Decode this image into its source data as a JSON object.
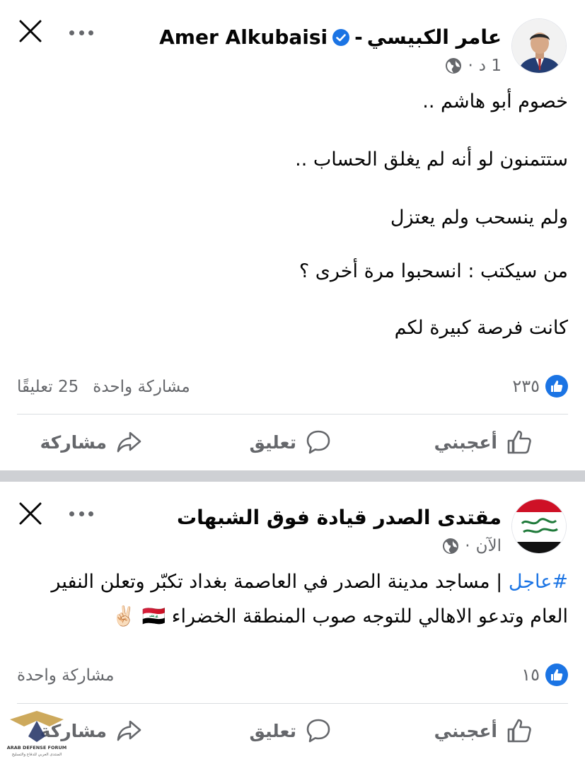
{
  "posts": [
    {
      "author": "Amer Alkubaisi  -  عامر الكبيسي",
      "author_ar": "عامر الكبيسي",
      "author_en": "Amer Alkubaisi",
      "author_sep": "-",
      "time": "1 د",
      "dot": "·",
      "body": [
        "خصوم أبو هاشم ..",
        "ستتمنون لو أنه لم يغلق الحساب ..",
        "ولم ينسحب ولم يعتزل",
        "من سيكتب : انسحبوا مرة أخرى ؟",
        "كانت فرصة كبيرة لكم"
      ],
      "likes": "٢٣٥",
      "shares": "مشاركة واحدة",
      "comments": "25 تعليقًا"
    },
    {
      "author": "مقتدى الصدر قيادة فوق الشبهات",
      "time": "الآن",
      "dot": "·",
      "hashtag": "#عاجل",
      "body_line1": "| مساجد مدينة الصدر في العاصمة بغداد تكبّر وتعلن النفير",
      "body_line2": "العام وتدعو الاهالي للتوجه صوب المنطقة الخضراء",
      "emoji": "🇮🇶 ✌🏻",
      "likes": "١٥",
      "shares": "مشاركة واحدة"
    }
  ],
  "actions": {
    "like": "أعجبني",
    "comment": "تعليق",
    "share": "مشاركة"
  },
  "watermark": {
    "line1": "ARAB DEFENSE FORUM",
    "line2": "المنتدى العربي للدفاع والتسليح"
  },
  "colors": {
    "accent": "#1b74e4",
    "muted": "#65676b",
    "separator": "#ced0d4"
  }
}
